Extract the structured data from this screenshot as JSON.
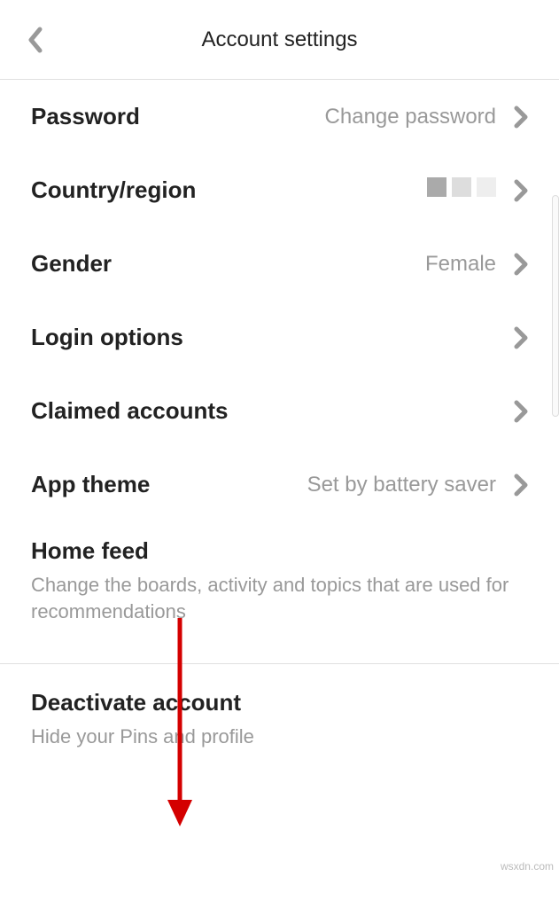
{
  "header": {
    "title": "Account settings"
  },
  "settings": {
    "password": {
      "label": "Password",
      "value": "Change password"
    },
    "country": {
      "label": "Country/region"
    },
    "gender": {
      "label": "Gender",
      "value": "Female"
    },
    "login_options": {
      "label": "Login options"
    },
    "claimed_accounts": {
      "label": "Claimed accounts"
    },
    "app_theme": {
      "label": "App theme",
      "value": "Set by battery saver"
    }
  },
  "home_feed": {
    "title": "Home feed",
    "desc": "Change the boards, activity and topics that are used for recommendations"
  },
  "deactivate": {
    "title": "Deactivate account",
    "desc": "Hide your Pins and profile"
  },
  "watermark": "wsxdn.com"
}
